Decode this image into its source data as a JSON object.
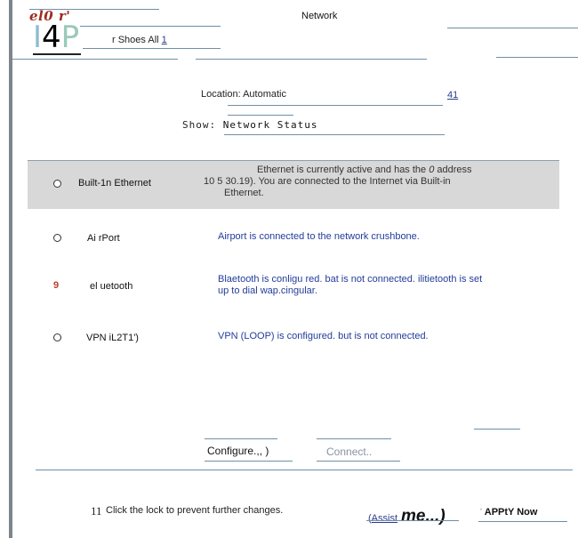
{
  "header": {
    "logo_top": "el0 r'",
    "logo_main": [
      "I",
      "4",
      "P"
    ],
    "title": "Network",
    "shoes_label": "r Shoes All",
    "shoes_num": "1"
  },
  "location": {
    "label": "Location: Automatic",
    "link": "41"
  },
  "show": {
    "label": "Show:",
    "value": "Network Status"
  },
  "services": [
    {
      "name": "Built-1n Ethernet",
      "status_symbol": "",
      "desc_line1": "Ethernet is currently active and has the ",
      "desc_italic": "0",
      "desc_line1b": " address",
      "desc_line2": "10 5 30.19). You are connected to the Internet via Built-in",
      "desc_line3": "Ethernet."
    },
    {
      "name": "Ai rPort",
      "desc": "Airport is connected to the network crushbone."
    },
    {
      "name": "el uetooth",
      "status_symbol": "9",
      "desc_line1": "Blaetooth is conligu red. bat is not connected. ilitietooth is set",
      "desc_line2": "up to dial wap.cingular."
    },
    {
      "name": "VPN iL2T1')",
      "desc": "VPN (LOOP) is configured. but is not connected."
    }
  ],
  "buttons": {
    "configure": "Configure.,, )",
    "connect": "Connect.."
  },
  "footer": {
    "lock_num": "11",
    "lock_text": "Click the lock to prevent further changes.",
    "assist_open": "(",
    "assist_link": "Assist",
    "assist_me": "me...)",
    "apply_tick": "'",
    "apply": "APPtY Now"
  }
}
